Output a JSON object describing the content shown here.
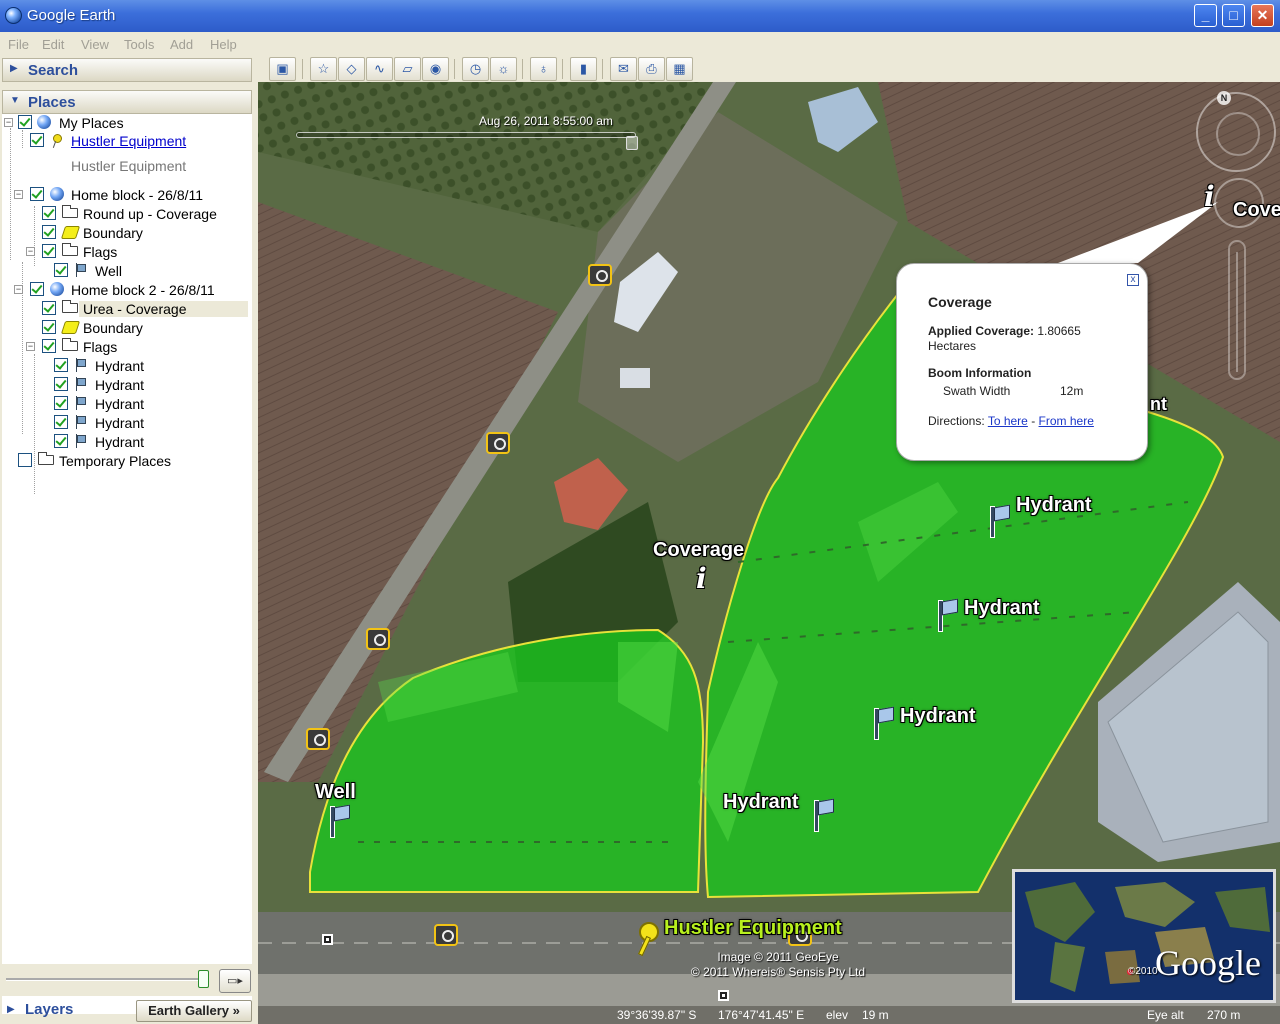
{
  "window": {
    "title": "Google Earth"
  },
  "menu": [
    "File",
    "Edit",
    "View",
    "Tools",
    "Add",
    "Help"
  ],
  "panels": {
    "search": "Search",
    "places": "Places",
    "layers": "Layers",
    "earth_gallery": "Earth Gallery"
  },
  "tree": [
    {
      "label": "My Places",
      "checked": true,
      "icon": "globe-icon"
    },
    {
      "label": "Hustler Equipment",
      "checked": true,
      "icon": "pushpin-icon",
      "link": true
    },
    {
      "label": "Hustler Equipment",
      "description": true
    },
    {
      "label": "Home block - 26/8/11",
      "checked": true,
      "icon": "globe-icon"
    },
    {
      "label": "Round up - Coverage",
      "checked": true,
      "icon": "folder-icon"
    },
    {
      "label": "Boundary",
      "checked": true,
      "icon": "polygon-icon"
    },
    {
      "label": "Flags",
      "checked": true,
      "icon": "folder-icon"
    },
    {
      "label": "Well",
      "checked": true,
      "icon": "flag-icon"
    },
    {
      "label": "Home block 2 - 26/8/11",
      "checked": true,
      "icon": "globe-icon"
    },
    {
      "label": "Urea - Coverage",
      "checked": true,
      "icon": "folder-icon",
      "selected": true
    },
    {
      "label": "Boundary",
      "checked": true,
      "icon": "polygon-icon"
    },
    {
      "label": "Flags",
      "checked": true,
      "icon": "folder-icon"
    },
    {
      "label": "Hydrant",
      "checked": true,
      "icon": "flag-icon"
    },
    {
      "label": "Hydrant",
      "checked": true,
      "icon": "flag-icon"
    },
    {
      "label": "Hydrant",
      "checked": true,
      "icon": "flag-icon"
    },
    {
      "label": "Hydrant",
      "checked": true,
      "icon": "flag-icon"
    },
    {
      "label": "Hydrant",
      "checked": true,
      "icon": "flag-icon"
    },
    {
      "label": "Temporary Places",
      "checked": false,
      "icon": "folder-icon"
    }
  ],
  "toolbar": {
    "buttons": [
      "sidebar-toggle-icon",
      "placemark-icon",
      "polygon-icon",
      "path-icon",
      "overlay-icon",
      "record-tour-icon",
      "historical-imagery-icon",
      "sunlight-icon",
      "planets-icon",
      "ruler-icon",
      "email-icon",
      "print-icon",
      "view-in-maps-icon"
    ]
  },
  "map": {
    "time": "Aug 26, 2011    8:55:00 am",
    "compass_north": "N",
    "labels": {
      "coverage": "Coverage",
      "coverage_clipped": "Cove",
      "well": "Well",
      "hydrants": [
        "Hydrant",
        "Hydrant",
        "Hydrant",
        "Hydrant"
      ],
      "hustler": "Hustler Equipment",
      "clipped_t": "nt"
    },
    "balloon": {
      "title": "Coverage",
      "applied_label": "Applied Coverage:",
      "applied_value": "1.80665",
      "applied_unit": "Hectares",
      "boom_heading": "Boom Information",
      "swath_label": "Swath Width",
      "swath_value": "12m",
      "directions_label": "Directions:",
      "to_here": "To here",
      "separator": "-",
      "from_here": "From here",
      "close": "x"
    },
    "attribution": [
      "Image © 2011 GeoEye",
      "© 2011 Whereis® Sensis Pty Ltd"
    ],
    "overview": {
      "logo": "Google",
      "year": "©2010"
    }
  },
  "status": {
    "lat": "39°36'39.87\" S",
    "lon": "176°47'41.45\" E",
    "elev_label": "elev",
    "elev_value": "19 m",
    "eye_label": "Eye alt",
    "eye_value": "270 m"
  },
  "colors": {
    "coverage_green": "#19c81e",
    "boundary_yellow": "#e8e23a",
    "title_bar_blue": "#2d5cc9",
    "panel_header_text": "#2d4f9c"
  }
}
